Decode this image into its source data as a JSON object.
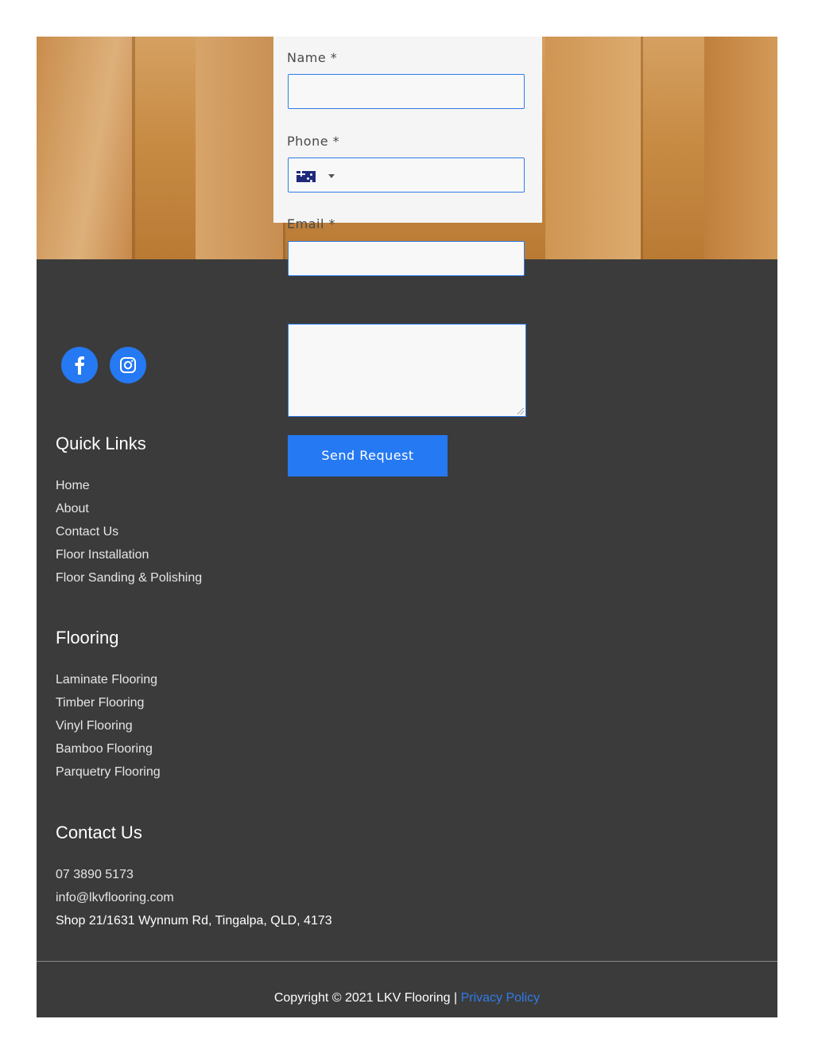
{
  "form": {
    "name_label": "Name *",
    "phone_label": "Phone *",
    "email_label": "Email *",
    "phone_country": "AU",
    "send_label": "Send Request"
  },
  "social": {
    "items": [
      {
        "icon": "facebook-icon"
      },
      {
        "icon": "instagram-icon"
      }
    ],
    "color": "#2579f2"
  },
  "quick_links": {
    "heading": "Quick Links",
    "items": [
      "Home",
      "About",
      "Contact Us",
      "Floor Installation",
      "Floor Sanding & Polishing"
    ]
  },
  "flooring": {
    "heading": "Flooring",
    "items": [
      "Laminate Flooring",
      "Timber Flooring",
      "Vinyl Flooring",
      "Bamboo Flooring",
      "Parquetry Flooring"
    ]
  },
  "contact": {
    "heading": "Contact Us",
    "phone": "07 3890 5173",
    "email": "info@lkvflooring.com",
    "address": "Shop 21/1631 Wynnum Rd, Tingalpa, QLD, 4173"
  },
  "footer": {
    "copyright": "Copyright © 2021 LKV Flooring | ",
    "privacy": "Privacy Policy"
  },
  "colors": {
    "accent": "#2579f2",
    "footer_bg": "#3b3b3b"
  }
}
